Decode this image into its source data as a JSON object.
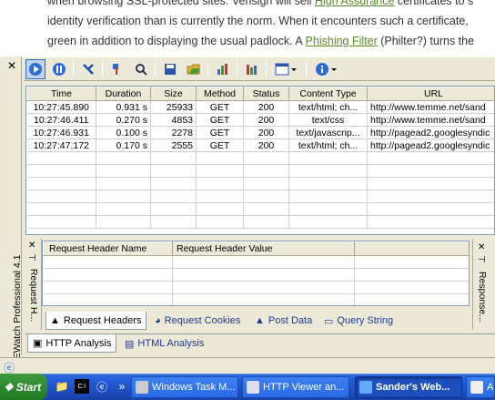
{
  "webpage": {
    "line1_pre": "when browsing SSL-protected sites. Verisign will sell ",
    "line1_link": "High Assurance",
    "line1_post": " certificates to s",
    "line2": "identity verification than is currently the norm. When it encounters such a certificate,",
    "line3_pre": "green in addition to displaying the usual padlock. A ",
    "line3_link": "Phishing Filter",
    "line3_post": " (Philter?) turns the"
  },
  "panel": {
    "close": "✕",
    "vertical_title": "IEWatch Professional 4.1"
  },
  "toolbar": {
    "icons": [
      "record-icon",
      "pause-icon",
      "clear-icon",
      "filter-icon",
      "find-icon",
      "save-icon",
      "open-icon",
      "chart-icon",
      "stats-icon",
      "layout-icon",
      "info-icon"
    ]
  },
  "grid": {
    "columns": [
      "Time",
      "Duration",
      "Size",
      "Method",
      "Status",
      "Content Type",
      "URL"
    ],
    "rows": [
      [
        "10:27:45.890",
        "0.931 s",
        "25933",
        "GET",
        "200",
        "text/html; ch...",
        "http://www.temme.net/sand"
      ],
      [
        "10:27:46.411",
        "0.270 s",
        "4853",
        "GET",
        "200",
        "text/css",
        "http://www.temme.net/sand"
      ],
      [
        "10:27:46.931",
        "0.100 s",
        "2278",
        "GET",
        "200",
        "text/javascrip...",
        "http://pagead2.googlesyndic"
      ],
      [
        "10:27:47.172",
        "0.170 s",
        "2555",
        "GET",
        "200",
        "text/html; ch...",
        "http://pagead2.googlesyndic"
      ]
    ]
  },
  "request_pane": {
    "side_label": "Request H...",
    "close": "✕",
    "pin": "⊣",
    "columns": [
      "Request Header Name",
      "Request Header Value"
    ],
    "subtabs": [
      "Request Headers",
      "Request Cookies",
      "Post Data",
      "Query String"
    ]
  },
  "response_pane": {
    "side_label": "Response...",
    "close": "✕",
    "pin": "⊣"
  },
  "main_tabs": [
    "HTTP Analysis",
    "HTML Analysis"
  ],
  "taskbar": {
    "start": "Start",
    "overflow": "»",
    "buttons": [
      "Windows Task M...",
      "HTTP Viewer an...",
      "Sander's Web...",
      "A"
    ]
  }
}
